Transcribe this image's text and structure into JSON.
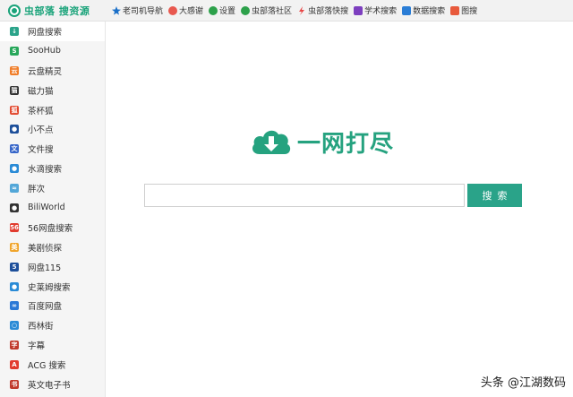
{
  "brand": {
    "text": "虫部落 搜资源"
  },
  "nav": [
    {
      "label": "老司机导航",
      "icon": "star-icon",
      "color": "#1a6fc8"
    },
    {
      "label": "大感谢",
      "icon": "heart-icon",
      "color": "#e8584f"
    },
    {
      "label": "设置",
      "icon": "gear-icon",
      "color": "#2da14b"
    },
    {
      "label": "虫部落社区",
      "icon": "chat-icon",
      "color": "#2da14b"
    },
    {
      "label": "虫部落快搜",
      "icon": "lightning-icon",
      "color": "#e84545"
    },
    {
      "label": "学术搜索",
      "icon": "graduation-cap-icon",
      "color": "#7d3fbf"
    },
    {
      "label": "数据搜索",
      "icon": "nodes-icon",
      "color": "#2a7dd6"
    },
    {
      "label": "图搜",
      "icon": "image-icon",
      "color": "#e85a3c"
    }
  ],
  "sidebar": {
    "items": [
      {
        "label": "网盘搜索",
        "icon": "cloud-download-icon",
        "color": "#2aa389",
        "glyph": "↓",
        "active": true
      },
      {
        "label": "SooHub",
        "icon": "soohub-icon",
        "color": "#27a75a",
        "glyph": "S"
      },
      {
        "label": "云盘精灵",
        "icon": "cloud-elf-icon",
        "color": "#f07c27",
        "glyph": "云"
      },
      {
        "label": "磁力猫",
        "icon": "cat-icon",
        "color": "#333333",
        "glyph": "猫"
      },
      {
        "label": "茶杯狐",
        "icon": "fox-icon",
        "color": "#e1472d",
        "glyph": "狐"
      },
      {
        "label": "小不点",
        "icon": "dot-icon",
        "color": "#1d4f9a",
        "glyph": "●"
      },
      {
        "label": "文件搜",
        "icon": "file-search-icon",
        "color": "#3766c9",
        "glyph": "文"
      },
      {
        "label": "水滴搜索",
        "icon": "water-drop-icon",
        "color": "#2a8bd6",
        "glyph": "●"
      },
      {
        "label": "胖次",
        "icon": "wave-icon",
        "color": "#53a7d8",
        "glyph": "≈"
      },
      {
        "label": "BiliWorld",
        "icon": "biliworld-icon",
        "color": "#333333",
        "glyph": "●"
      },
      {
        "label": "56网盘搜索",
        "icon": "56-icon",
        "color": "#e13c2f",
        "glyph": "56"
      },
      {
        "label": "美剧侦探",
        "icon": "detective-icon",
        "color": "#f0a429",
        "glyph": "美"
      },
      {
        "label": "网盘115",
        "icon": "115-icon",
        "color": "#1d4f9a",
        "glyph": "5"
      },
      {
        "label": "史莱姆搜索",
        "icon": "slime-icon",
        "color": "#2a8bd6",
        "glyph": "●"
      },
      {
        "label": "百度网盘",
        "icon": "baidu-pan-icon",
        "color": "#2a78d6",
        "glyph": "∞"
      },
      {
        "label": "西林街",
        "icon": "xilinjie-icon",
        "color": "#2a8bd6",
        "glyph": "○"
      },
      {
        "label": "字幕",
        "icon": "subtitle-icon",
        "color": "#c0392b",
        "glyph": "字"
      },
      {
        "label": "ACG 搜索",
        "icon": "acg-icon",
        "color": "#e13c2f",
        "glyph": "A"
      },
      {
        "label": "英文电子书",
        "icon": "ebook-icon",
        "color": "#c0392b",
        "glyph": "书"
      }
    ]
  },
  "main": {
    "logo_text": "一网打尽",
    "search_placeholder": "",
    "search_value": "",
    "search_button": "搜索"
  },
  "watermark": {
    "text": "头条 @江湖数码"
  },
  "colors": {
    "accent": "#2aa389",
    "brand": "#1aa37a"
  }
}
